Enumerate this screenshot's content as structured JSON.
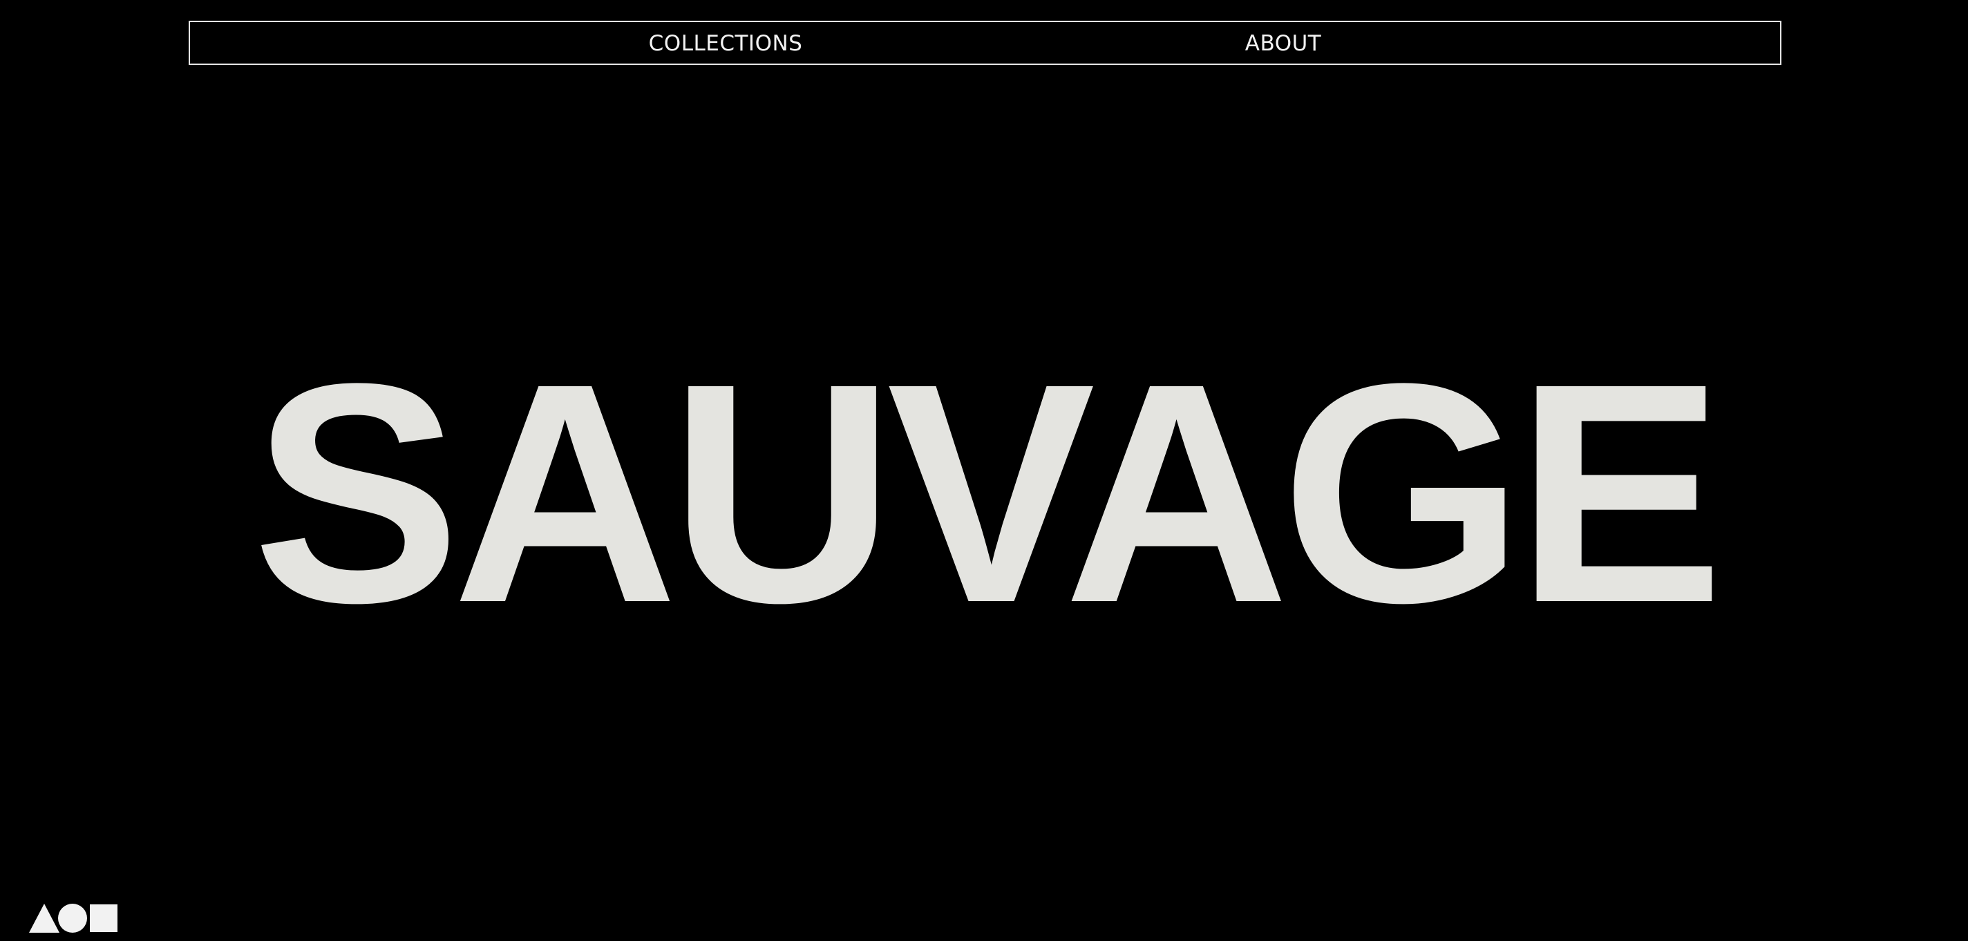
{
  "nav": {
    "items": [
      {
        "label": "COLLECTIONS"
      },
      {
        "label": "ABOUT"
      }
    ]
  },
  "hero": {
    "title": "SAUVAGE"
  },
  "logo": {
    "icons": [
      "triangle-icon",
      "circle-icon",
      "square-icon"
    ]
  },
  "colors": {
    "background": "#000000",
    "hero_text": "#e4e4e0",
    "nav_text": "#f2f2f2",
    "nav_border": "#e6e6e6"
  }
}
